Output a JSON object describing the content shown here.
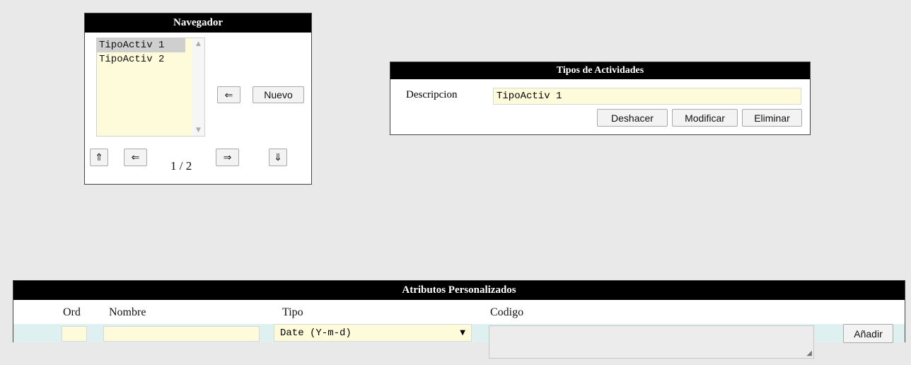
{
  "navegador": {
    "title": "Navegador",
    "items": [
      "TipoActiv 1",
      "TipoActiv 2"
    ],
    "selected_index": 0,
    "counter": "1 / 2",
    "buttons": {
      "back": "⇐",
      "new": "Nuevo",
      "first": "⇑",
      "prev": "⇐",
      "next": "⇒",
      "last": "⇓"
    }
  },
  "tipos": {
    "title": "Tipos de Actividades",
    "desc_label": "Descripcion",
    "desc_value": "TipoActiv 1",
    "buttons": {
      "undo": "Deshacer",
      "modify": "Modificar",
      "delete": "Eliminar"
    }
  },
  "atributos": {
    "title": "Atributos Personalizados",
    "columns": {
      "ord": "Ord",
      "nombre": "Nombre",
      "tipo": "Tipo",
      "codigo": "Codigo"
    },
    "row": {
      "ord": "",
      "nombre": "",
      "tipo": "Date (Y-m-d)",
      "codigo": ""
    },
    "add_label": "Añadir"
  },
  "colors": {
    "input_bg": "#fdfbda",
    "row_bg": "#dff0f0",
    "header_bg": "#000000"
  }
}
